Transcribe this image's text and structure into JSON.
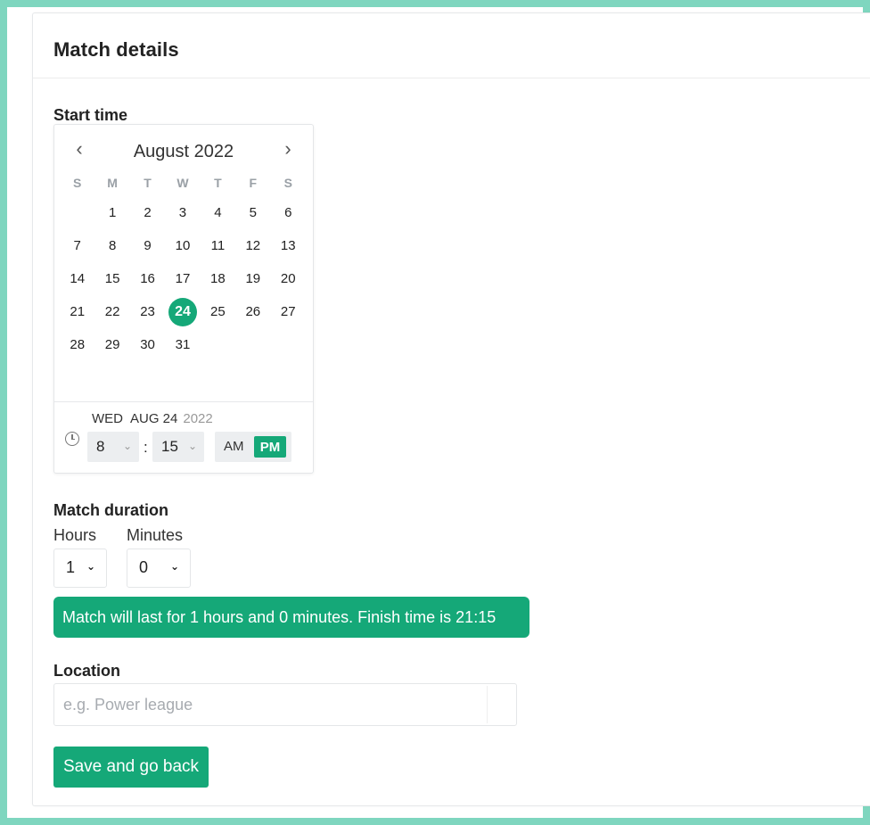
{
  "card": {
    "title": "Match details"
  },
  "start_time": {
    "label": "Start time",
    "calendar": {
      "month_label": "August 2022",
      "prev_icon": "chevron-left-icon",
      "next_icon": "chevron-right-icon",
      "weekdays": [
        "S",
        "M",
        "T",
        "W",
        "T",
        "F",
        "S"
      ],
      "weeks": [
        [
          "",
          "1",
          "2",
          "3",
          "4",
          "5",
          "6"
        ],
        [
          "7",
          "8",
          "9",
          "10",
          "11",
          "12",
          "13"
        ],
        [
          "14",
          "15",
          "16",
          "17",
          "18",
          "19",
          "20"
        ],
        [
          "21",
          "22",
          "23",
          "24",
          "25",
          "26",
          "27"
        ],
        [
          "28",
          "29",
          "30",
          "31",
          "",
          "",
          ""
        ]
      ],
      "selected_day": "24"
    },
    "selected_date": {
      "weekday": "WED",
      "month_day": "AUG 24",
      "year": "2022"
    },
    "time": {
      "hour": "8",
      "minute": "15",
      "am_label": "AM",
      "pm_label": "PM",
      "period": "PM"
    }
  },
  "duration": {
    "label": "Match duration",
    "hours_label": "Hours",
    "minutes_label": "Minutes",
    "hours_value": "1",
    "minutes_value": "0",
    "summary": "Match will last for 1 hours and 0 minutes. Finish time is 21:15"
  },
  "location": {
    "label": "Location",
    "placeholder": "e.g. Power league",
    "value": ""
  },
  "actions": {
    "save_label": "Save and go back"
  },
  "colors": {
    "accent": "#15a878",
    "frame": "#7fd6bf"
  }
}
